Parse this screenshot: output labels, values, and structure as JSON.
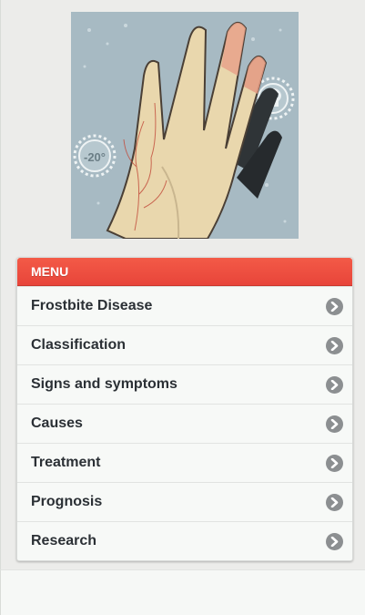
{
  "hero": {
    "badge_text": "-20°"
  },
  "menu": {
    "header": "MENU",
    "items": [
      {
        "label": "Frostbite Disease",
        "icon": "chevron-right-icon"
      },
      {
        "label": "Classification",
        "icon": "chevron-right-icon"
      },
      {
        "label": "Signs and symptoms",
        "icon": "chevron-right-icon"
      },
      {
        "label": "Causes",
        "icon": "chevron-right-icon"
      },
      {
        "label": "Treatment",
        "icon": "chevron-right-icon"
      },
      {
        "label": "Prognosis",
        "icon": "chevron-right-icon"
      },
      {
        "label": "Research",
        "icon": "chevron-right-icon"
      }
    ]
  },
  "colors": {
    "menu_header": "#ee4f40",
    "chevron": "#8c8f91",
    "text": "#2b3035"
  }
}
